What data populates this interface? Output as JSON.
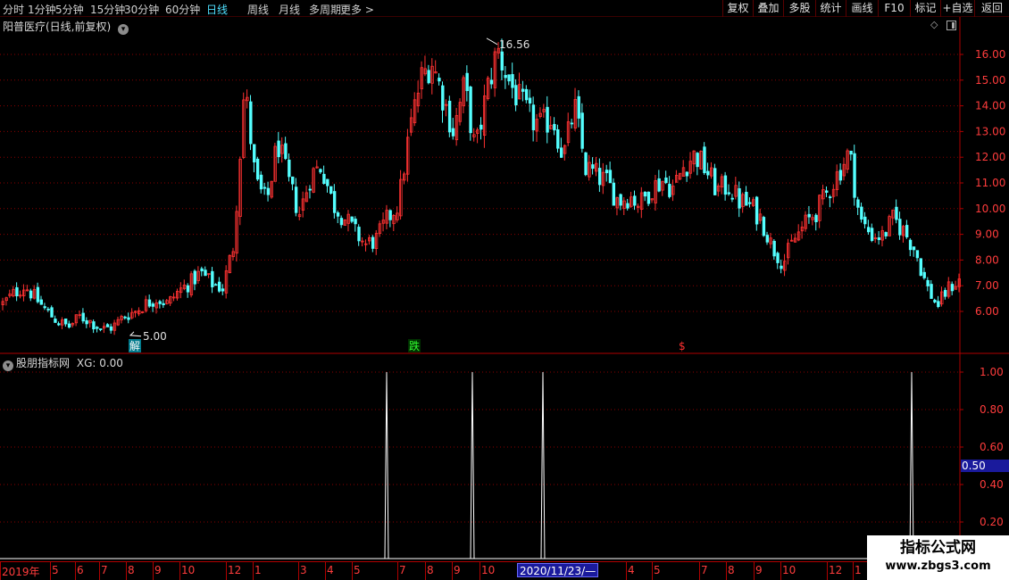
{
  "toolbar": {
    "periods": [
      "分时",
      "1分钟",
      "5分钟",
      "15分钟",
      "30分钟",
      "60分钟",
      "日线",
      "周线",
      "月线",
      "多周期",
      "更多 >"
    ],
    "active_period": "日线",
    "tools": [
      "复权",
      "叠加",
      "多股",
      "统计",
      "画线",
      "F10",
      "标记",
      "+自选",
      "返回"
    ]
  },
  "main_panel": {
    "title": "阳普医疗(日线,前复权)",
    "price_axis": [
      "16.00",
      "15.00",
      "14.00",
      "13.00",
      "12.00",
      "11.00",
      "10.00",
      "9.00",
      "8.00",
      "7.00",
      "6.00"
    ],
    "high_label": "16.56",
    "low_label": "5.00",
    "markers": [
      {
        "text": "解",
        "color": "#ffffff",
        "bg": "#007a8c"
      },
      {
        "text": "跌",
        "color": "#30ff30",
        "bg": "#003000"
      },
      {
        "text": "$",
        "color": "#ff3030",
        "bg": "#000000"
      }
    ]
  },
  "sub_panel": {
    "title": "股朋指标网",
    "value_label": "XG: 0.00",
    "axis": [
      "1.00",
      "0.80",
      "0.60",
      "0.40",
      "0.20"
    ],
    "highlight_value": "0.50"
  },
  "date_axis": {
    "labels": [
      "2019年",
      "5",
      "6",
      "7",
      "8",
      "9",
      "10",
      "12",
      "1",
      "3",
      "4",
      "5",
      "7",
      "8",
      "9",
      "10",
      "4",
      "5",
      "7",
      "8",
      "9",
      "10",
      "12",
      "1"
    ],
    "cursor_date": "2020/11/23/—"
  },
  "watermark": {
    "title": "指标公式网",
    "url": "www.zbgs3.com"
  },
  "colors": {
    "up": "#ff3232",
    "down": "#54ffff",
    "grid": "#8b0000",
    "axis_text": "#ff3c3c",
    "active_tab": "#4fe0ff"
  },
  "chart_data": {
    "type": "candlestick",
    "title": "阳普医疗(日线,前复权)",
    "y_range": [
      5.0,
      16.56
    ],
    "annotated_max": 16.56,
    "annotated_min": 5.0,
    "approx_close_path": [
      6.3,
      6.7,
      7.0,
      6.5,
      6.0,
      5.6,
      5.4,
      5.8,
      5.6,
      5.3,
      5.4,
      5.8,
      6.0,
      6.3,
      6.5,
      6.3,
      6.8,
      7.1,
      7.5,
      7.1,
      6.9,
      8.6,
      14.8,
      11.0,
      10.2,
      12.6,
      11.0,
      9.8,
      11.3,
      11.7,
      10.2,
      9.7,
      9.1,
      8.6,
      8.8,
      9.6,
      10.2,
      13.0,
      15.0,
      15.8,
      14.4,
      13.0,
      14.8,
      12.2,
      14.5,
      16.2,
      15.0,
      14.2,
      13.5,
      13.2,
      13.6,
      12.0,
      14.0,
      11.6,
      11.3,
      11.0,
      10.3,
      10.5,
      10.2,
      10.8,
      11.1,
      10.8,
      11.7,
      12.1,
      11.5,
      10.7,
      10.9,
      10.3,
      10.1,
      9.6,
      8.5,
      7.9,
      8.8,
      9.4,
      9.9,
      10.6,
      11.4,
      12.2,
      9.5,
      9.0,
      8.9,
      9.6,
      9.1,
      8.4,
      7.0,
      6.2,
      6.9,
      7.2
    ],
    "sub_indicator": {
      "name": "XG",
      "current": 0.0,
      "y_range": [
        0,
        1
      ],
      "signals": [
        {
          "date_approx": "2020-06",
          "value": 1.0
        },
        {
          "date_approx": "2020-09",
          "value": 1.0
        },
        {
          "date_approx": "2020-11",
          "value": 1.0
        },
        {
          "date_approx": "2022-01",
          "value": 1.0
        }
      ]
    }
  }
}
